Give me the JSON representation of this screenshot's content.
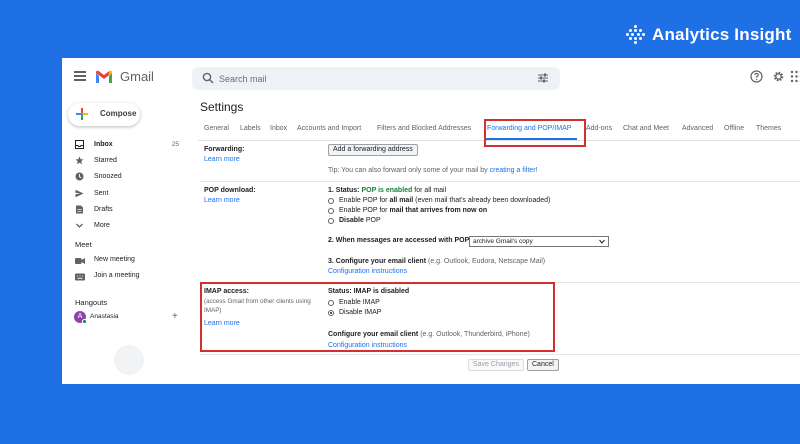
{
  "brand": {
    "name": "Analytics Insight"
  },
  "app": {
    "name": "Gmail"
  },
  "search": {
    "placeholder": "Search mail"
  },
  "compose": {
    "label": "Compose"
  },
  "nav": [
    {
      "label": "Inbox",
      "count": "25",
      "icon": "inbox-icon"
    },
    {
      "label": "Starred",
      "count": "",
      "icon": "star-icon"
    },
    {
      "label": "Snoozed",
      "count": "",
      "icon": "clock-icon"
    },
    {
      "label": "Sent",
      "count": "",
      "icon": "send-icon"
    },
    {
      "label": "Drafts",
      "count": "",
      "icon": "draft-icon"
    },
    {
      "label": "More",
      "count": "",
      "icon": "chevron-down-icon"
    }
  ],
  "meet": {
    "title": "Meet",
    "new_meeting": "New meeting",
    "join_meeting": "Join a meeting"
  },
  "hangouts": {
    "title": "Hangouts",
    "user": "Anastasia",
    "initial": "A"
  },
  "settings": {
    "title": "Settings",
    "tabs": [
      "General",
      "Labels",
      "Inbox",
      "Accounts and Import",
      "Filters and Blocked Addresses",
      "Forwarding and POP/IMAP",
      "Add-ons",
      "Chat and Meet",
      "Advanced",
      "Offline",
      "Themes"
    ],
    "active_tab": "Forwarding and POP/IMAP",
    "learn_more": "Learn more",
    "forwarding": {
      "label": "Forwarding:",
      "add_button": "Add a forwarding address",
      "tip_prefix": "Tip: You can also forward only some of your mail by",
      "tip_link": "creating a filter!"
    },
    "pop": {
      "label": "POP download:",
      "status_prefix": "1. Status:",
      "status_value": "POP is enabled",
      "status_suffix": "for all mail",
      "options": [
        {
          "pre": "Enable POP for",
          "bold": "all mail",
          "post": "(even mail that's already been downloaded)",
          "selected": false
        },
        {
          "pre": "Enable POP for",
          "bold": "mail that arrives from now on",
          "post": "",
          "selected": false
        },
        {
          "pre": "",
          "bold": "Disable",
          "post": "POP",
          "selected": false
        }
      ],
      "step2": "2. When messages are accessed with POP",
      "step2_value": "archive Gmail's copy",
      "step3": "3. Configure your email client",
      "step3_note": "(e.g. Outlook, Eudora, Netscape Mail)",
      "config_link": "Configuration instructions"
    },
    "imap": {
      "label": "IMAP access:",
      "sublabel": "(access Gmail from other clients using IMAP)",
      "status": "Status: IMAP is disabled",
      "options": [
        {
          "label": "Enable IMAP",
          "selected": false
        },
        {
          "label": "Disable IMAP",
          "selected": true
        }
      ],
      "configure": "Configure your email client",
      "configure_note": "(e.g. Outlook, Thunderbird, iPhone)",
      "config_link": "Configuration instructions"
    },
    "save_label": "Save Changes",
    "cancel_label": "Cancel"
  },
  "colors": {
    "background": "#1f6fe5",
    "accent": "#1a73e8",
    "highlight": "#d32f2f",
    "enabled": "#188038"
  }
}
